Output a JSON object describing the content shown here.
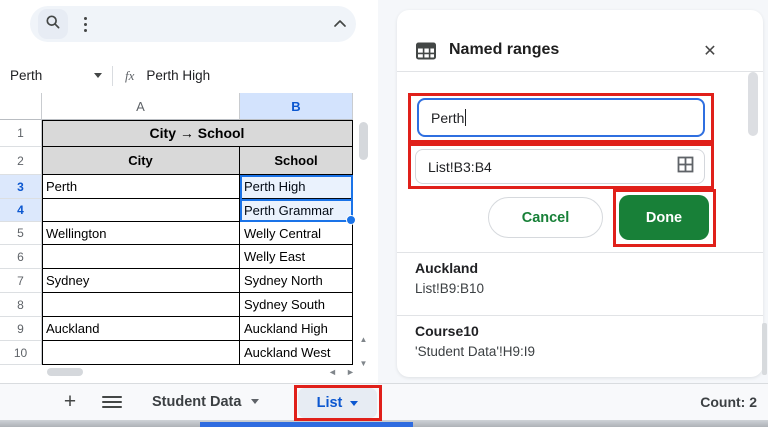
{
  "toolbar": {
    "icons": {
      "search": "magnifier",
      "more": "kebab-vertical",
      "collapse": "chevron-up"
    }
  },
  "formula_bar": {
    "name_box_value": "Perth",
    "fx_label": "fx",
    "formula_value": "Perth High"
  },
  "grid": {
    "column_headers": [
      "A",
      "B"
    ],
    "selected_range": "B3:B4",
    "rows": [
      {
        "num": "1",
        "a": "City → School",
        "b": ""
      },
      {
        "num": "2",
        "a": "City",
        "b": "School"
      },
      {
        "num": "3",
        "a": "Perth",
        "b": "Perth High"
      },
      {
        "num": "4",
        "a": "",
        "b": "Perth Grammar"
      },
      {
        "num": "5",
        "a": "Wellington",
        "b": "Welly Central"
      },
      {
        "num": "6",
        "a": "",
        "b": "Welly East"
      },
      {
        "num": "7",
        "a": "Sydney",
        "b": "Sydney North"
      },
      {
        "num": "8",
        "a": "",
        "b": "Sydney South"
      },
      {
        "num": "9",
        "a": "Auckland",
        "b": "Auckland High"
      },
      {
        "num": "10",
        "a": "",
        "b": "Auckland West"
      }
    ]
  },
  "panel": {
    "title": "Named ranges",
    "close_glyph": "✕",
    "name_input": {
      "value": "Perth"
    },
    "range_field": {
      "value": "List!B3:B4"
    },
    "cancel_label": "Cancel",
    "done_label": "Done",
    "named_ranges": [
      {
        "name": "Auckland",
        "range": "List!B9:B10"
      },
      {
        "name": "Course10",
        "range": "'Student Data'!H9:I9"
      }
    ],
    "icons": {
      "panel": "table-grid",
      "close": "x",
      "range_picker": "grid-select"
    }
  },
  "sheet_bar": {
    "add_label": "+",
    "icons": {
      "add_sheet": "plus",
      "all_sheets": "hamburger"
    },
    "tabs": [
      {
        "label": "Student Data",
        "active": false
      },
      {
        "label": "List",
        "active": true
      }
    ],
    "count_label": "Count: 2"
  },
  "colors": {
    "accent_blue": "#1a73e8",
    "link_blue": "#0b57d0",
    "green": "#188038",
    "annotation_red": "#e0201a",
    "table_header_gray": "#d9d9d9",
    "selected_header_blue": "#d3e3fd"
  }
}
